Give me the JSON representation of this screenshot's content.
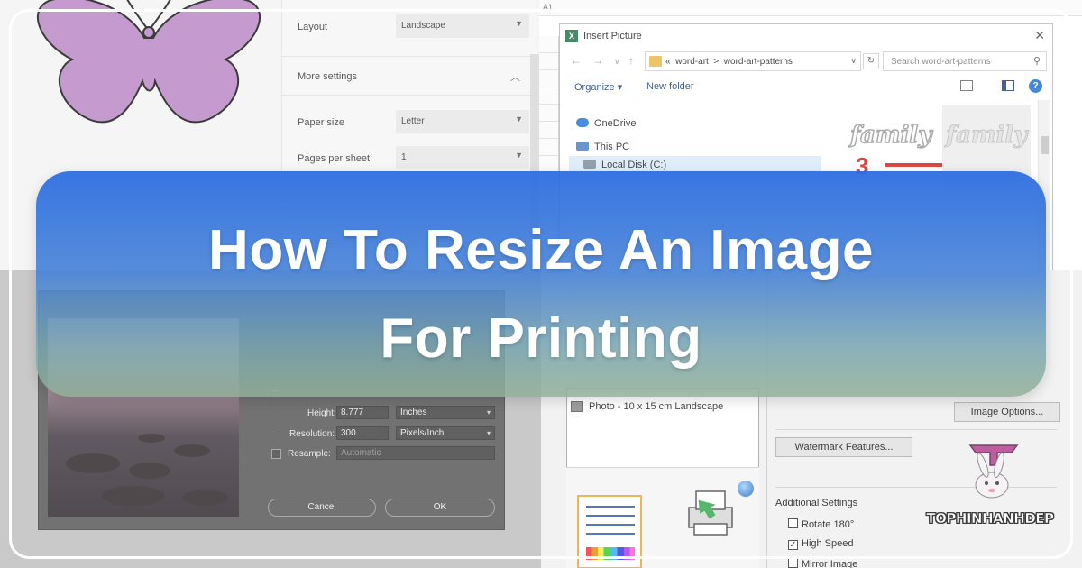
{
  "print_settings": {
    "layout_label": "Layout",
    "layout_value": "Landscape",
    "more_settings_label": "More settings",
    "paper_size_label": "Paper size",
    "paper_size_value": "Letter",
    "pages_per_sheet_label": "Pages per sheet",
    "pages_per_sheet_value": "1"
  },
  "excel": {
    "cell_ref": "A1"
  },
  "insert_picture": {
    "title": "Insert Picture",
    "path_prefix": "«",
    "path_1": "word-art",
    "path_sep": ">",
    "path_2": "word-art-patterns",
    "search_placeholder": "Search word-art-patterns",
    "organize_label": "Organize ▾",
    "new_folder_label": "New folder",
    "tree": [
      {
        "label": "OneDrive"
      },
      {
        "label": "This PC"
      },
      {
        "label": "Local Disk (C:)"
      }
    ],
    "thumb_text": "family",
    "thumb_number": "3"
  },
  "image_size": {
    "height_label": "Height:",
    "height_value": "8.777",
    "height_unit": "Inches",
    "resolution_label": "Resolution:",
    "resolution_value": "300",
    "resolution_unit": "Pixels/Inch",
    "resample_label": "Resample:",
    "resample_value": "Automatic",
    "cancel_label": "Cancel",
    "ok_label": "OK"
  },
  "print_dialog": {
    "photo_option": "Photo - 10 x 15 cm Landscape",
    "image_options_label": "Image Options...",
    "watermark_label": "Watermark Features...",
    "additional_settings_label": "Additional Settings",
    "rotate_label": "Rotate 180°",
    "high_speed_label": "High Speed",
    "mirror_label": "Mirror Image",
    "high_speed_checked": true,
    "rotate_checked": false
  },
  "banner": {
    "line1": "How To Resize An Image",
    "line2": "For Printing"
  },
  "brand": {
    "name": "TOPHINHANHDEP"
  },
  "colors": {
    "banner_top": "#2d6ee1",
    "banner_bottom": "#91af96",
    "butterfly": "#b784c5",
    "accent_red": "#d21f1f"
  }
}
